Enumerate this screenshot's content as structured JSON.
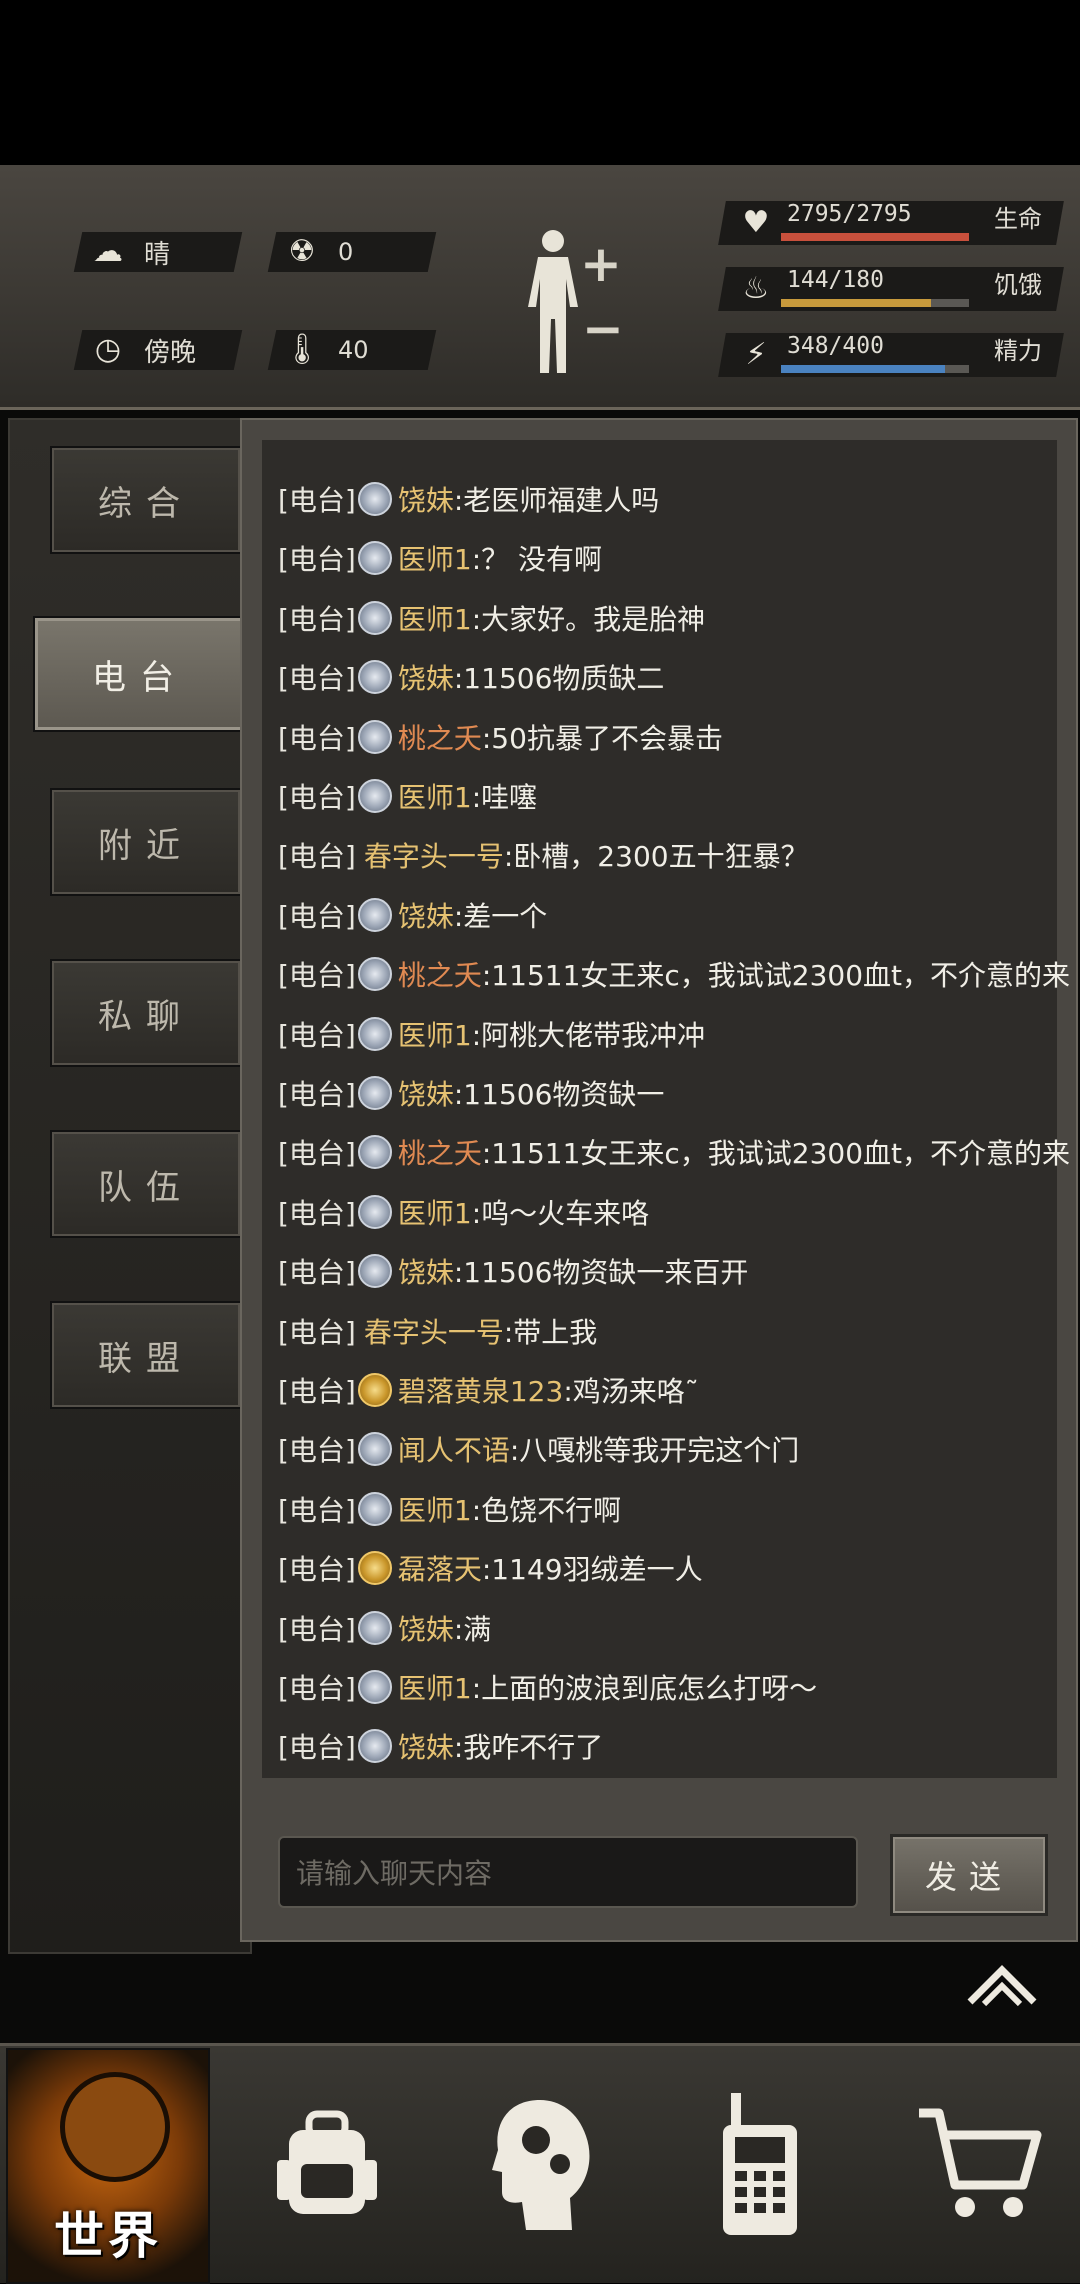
{
  "status": {
    "weather": {
      "icon": "cloud-sun-icon",
      "label": "晴"
    },
    "radiation": {
      "icon": "radiation-icon",
      "value": "0"
    },
    "time_of_day": {
      "icon": "clock-icon",
      "label": "傍晚"
    },
    "temperature": {
      "icon": "thermometer-icon",
      "value": "40"
    },
    "life": {
      "value": "2795/2795",
      "label": "生命",
      "fraction": 1.0,
      "color": "#c8503c"
    },
    "hunger": {
      "value": "144/180",
      "label": "饥饿",
      "fraction": 0.8,
      "color": "#c89a3c"
    },
    "energy": {
      "value": "348/400",
      "label": "精力",
      "fraction": 0.87,
      "color": "#4a82c0"
    },
    "body": {
      "plus": "+",
      "minus": "−"
    }
  },
  "tabs": [
    {
      "label": "综合",
      "active": false
    },
    {
      "label": "电台",
      "active": true
    },
    {
      "label": "附近",
      "active": false
    },
    {
      "label": "私聊",
      "active": false
    },
    {
      "label": "队伍",
      "active": false
    },
    {
      "label": "联盟",
      "active": false
    }
  ],
  "colors": {
    "name_gold": "#e6c272",
    "name_orange": "#e08a52",
    "text": "#f0eee6"
  },
  "messages": [
    {
      "channel": "[电台]",
      "badge": "silver",
      "name": "饶妹",
      "name_color": "gold",
      "text": ":老医师福建人吗"
    },
    {
      "channel": "[电台]",
      "badge": "silver",
      "name": "医师1",
      "name_color": "gold",
      "text": ":？ 没有啊"
    },
    {
      "channel": "[电台]",
      "badge": "silver",
      "name": "医师1",
      "name_color": "gold",
      "text": ":大家好。我是胎神"
    },
    {
      "channel": "[电台]",
      "badge": "silver",
      "name": "饶妹",
      "name_color": "gold",
      "text": ":11506物质缺二"
    },
    {
      "channel": "[电台]",
      "badge": "silver",
      "name": "桃之夭",
      "name_color": "orange",
      "text": ":50抗暴了不会暴击"
    },
    {
      "channel": "[电台]",
      "badge": "silver",
      "name": "医师1",
      "name_color": "gold",
      "text": ":哇噻"
    },
    {
      "channel": "[电台]",
      "badge": "none",
      "name": "春字头一号",
      "name_color": "gold",
      "text": ":卧槽，2300五十狂暴？"
    },
    {
      "channel": "[电台]",
      "badge": "silver",
      "name": "饶妹",
      "name_color": "gold",
      "text": ":差一个"
    },
    {
      "channel": "[电台]",
      "badge": "silver",
      "name": "桃之夭",
      "name_color": "orange",
      "text": ":11511女王来c，我试试2300血t，不介意的来"
    },
    {
      "channel": "[电台]",
      "badge": "silver",
      "name": "医师1",
      "name_color": "gold",
      "text": ":阿桃大佬带我冲冲"
    },
    {
      "channel": "[电台]",
      "badge": "silver",
      "name": "饶妹",
      "name_color": "gold",
      "text": ":11506物资缺一"
    },
    {
      "channel": "[电台]",
      "badge": "silver",
      "name": "桃之夭",
      "name_color": "orange",
      "text": ":11511女王来c，我试试2300血t，不介意的来"
    },
    {
      "channel": "[电台]",
      "badge": "silver",
      "name": "医师1",
      "name_color": "gold",
      "text": ":呜～火车来咯"
    },
    {
      "channel": "[电台]",
      "badge": "silver",
      "name": "饶妹",
      "name_color": "gold",
      "text": ":11506物资缺一来百开"
    },
    {
      "channel": "[电台]",
      "badge": "none",
      "name": "春字头一号",
      "name_color": "gold",
      "text": ":带上我"
    },
    {
      "channel": "[电台]",
      "badge": "gold",
      "name": "碧落黄泉123",
      "name_color": "gold",
      "text": ":鸡汤来咯˜"
    },
    {
      "channel": "[电台]",
      "badge": "silver",
      "name": "闻人不语",
      "name_color": "gold",
      "text": ":八嘎桃等我开完这个门"
    },
    {
      "channel": "[电台]",
      "badge": "silver",
      "name": "医师1",
      "name_color": "gold",
      "text": ":色饶不行啊"
    },
    {
      "channel": "[电台]",
      "badge": "gold",
      "name": "磊落天",
      "name_color": "gold",
      "text": ":1149羽绒差一人"
    },
    {
      "channel": "[电台]",
      "badge": "silver",
      "name": "饶妹",
      "name_color": "gold",
      "text": ":满"
    },
    {
      "channel": "[电台]",
      "badge": "silver",
      "name": "医师1",
      "name_color": "gold",
      "text": ":上面的波浪到底怎么打呀～"
    },
    {
      "channel": "[电台]",
      "badge": "silver",
      "name": "饶妹",
      "name_color": "gold",
      "text": ":我咋不行了"
    }
  ],
  "chat_input": {
    "placeholder": "请输入聊天内容",
    "send_label": "发送"
  },
  "collapse_icon": "chevron-up-icon",
  "nav": [
    {
      "icon": "globe-icon",
      "label": "世界",
      "active": true
    },
    {
      "icon": "backpack-icon",
      "label": ""
    },
    {
      "icon": "head-gears-icon",
      "label": ""
    },
    {
      "icon": "walkie-talkie-icon",
      "label": ""
    },
    {
      "icon": "cart-icon",
      "label": ""
    }
  ]
}
